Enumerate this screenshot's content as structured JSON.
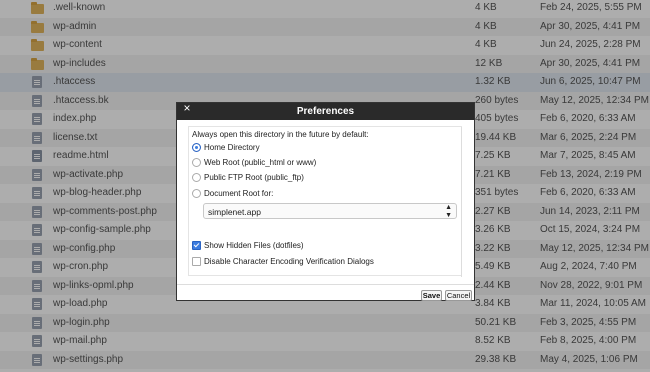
{
  "files": [
    {
      "name": ".well-known",
      "size": "4 KB",
      "date": "Feb 24, 2025, 5:55 PM",
      "type": "folder"
    },
    {
      "name": "wp-admin",
      "size": "4 KB",
      "date": "Apr 30, 2025, 4:41 PM",
      "type": "folder"
    },
    {
      "name": "wp-content",
      "size": "4 KB",
      "date": "Jun 24, 2025, 2:28 PM",
      "type": "folder"
    },
    {
      "name": "wp-includes",
      "size": "12 KB",
      "date": "Apr 30, 2025, 4:41 PM",
      "type": "folder"
    },
    {
      "name": ".htaccess",
      "size": "1.32 KB",
      "date": "Jun 6, 2025, 10:47 PM",
      "type": "file",
      "selected": true
    },
    {
      "name": ".htaccess.bk",
      "size": "260 bytes",
      "date": "May 12, 2025, 12:34 PM",
      "type": "file"
    },
    {
      "name": "index.php",
      "size": "405 bytes",
      "date": "Feb 6, 2020, 6:33 AM",
      "type": "file"
    },
    {
      "name": "license.txt",
      "size": "19.44 KB",
      "date": "Mar 6, 2025, 2:24 PM",
      "type": "file"
    },
    {
      "name": "readme.html",
      "size": "7.25 KB",
      "date": "Mar 7, 2025, 8:45 AM",
      "type": "html"
    },
    {
      "name": "wp-activate.php",
      "size": "7.21 KB",
      "date": "Feb 13, 2024, 2:19 PM",
      "type": "file"
    },
    {
      "name": "wp-blog-header.php",
      "size": "351 bytes",
      "date": "Feb 6, 2020, 6:33 AM",
      "type": "file"
    },
    {
      "name": "wp-comments-post.php",
      "size": "2.27 KB",
      "date": "Jun 14, 2023, 2:11 PM",
      "type": "file"
    },
    {
      "name": "wp-config-sample.php",
      "size": "3.26 KB",
      "date": "Oct 15, 2024, 3:24 PM",
      "type": "file"
    },
    {
      "name": "wp-config.php",
      "size": "3.22 KB",
      "date": "May 12, 2025, 12:34 PM",
      "type": "file"
    },
    {
      "name": "wp-cron.php",
      "size": "5.49 KB",
      "date": "Aug 2, 2024, 7:40 PM",
      "type": "file"
    },
    {
      "name": "wp-links-opml.php",
      "size": "2.44 KB",
      "date": "Nov 28, 2022, 9:01 PM",
      "type": "file"
    },
    {
      "name": "wp-load.php",
      "size": "3.84 KB",
      "date": "Mar 11, 2024, 10:05 AM",
      "type": "file"
    },
    {
      "name": "wp-login.php",
      "size": "50.21 KB",
      "date": "Feb 3, 2025, 4:55 PM",
      "type": "file"
    },
    {
      "name": "wp-mail.php",
      "size": "8.52 KB",
      "date": "Feb 8, 2025, 4:00 PM",
      "type": "file"
    },
    {
      "name": "wp-settings.php",
      "size": "29.38 KB",
      "date": "May 4, 2025, 1:06 PM",
      "type": "file"
    }
  ],
  "dialog": {
    "title": "Preferences",
    "close_label": "×",
    "prompt": "Always open this directory in the future by default:",
    "options": [
      {
        "label": "Home Directory",
        "selected": true
      },
      {
        "label": "Web Root (public_html or www)",
        "selected": false
      },
      {
        "label": "Public FTP Root (public_ftp)",
        "selected": false
      },
      {
        "label": "Document Root for:",
        "selected": false
      }
    ],
    "docroot_value": "simplenet.app",
    "show_hidden_label": "Show Hidden Files (dotfiles)",
    "show_hidden_checked": true,
    "disable_encoding_label": "Disable Character Encoding Verification Dialogs",
    "disable_encoding_checked": false,
    "save_label": "Save",
    "cancel_label": "Cancel"
  }
}
